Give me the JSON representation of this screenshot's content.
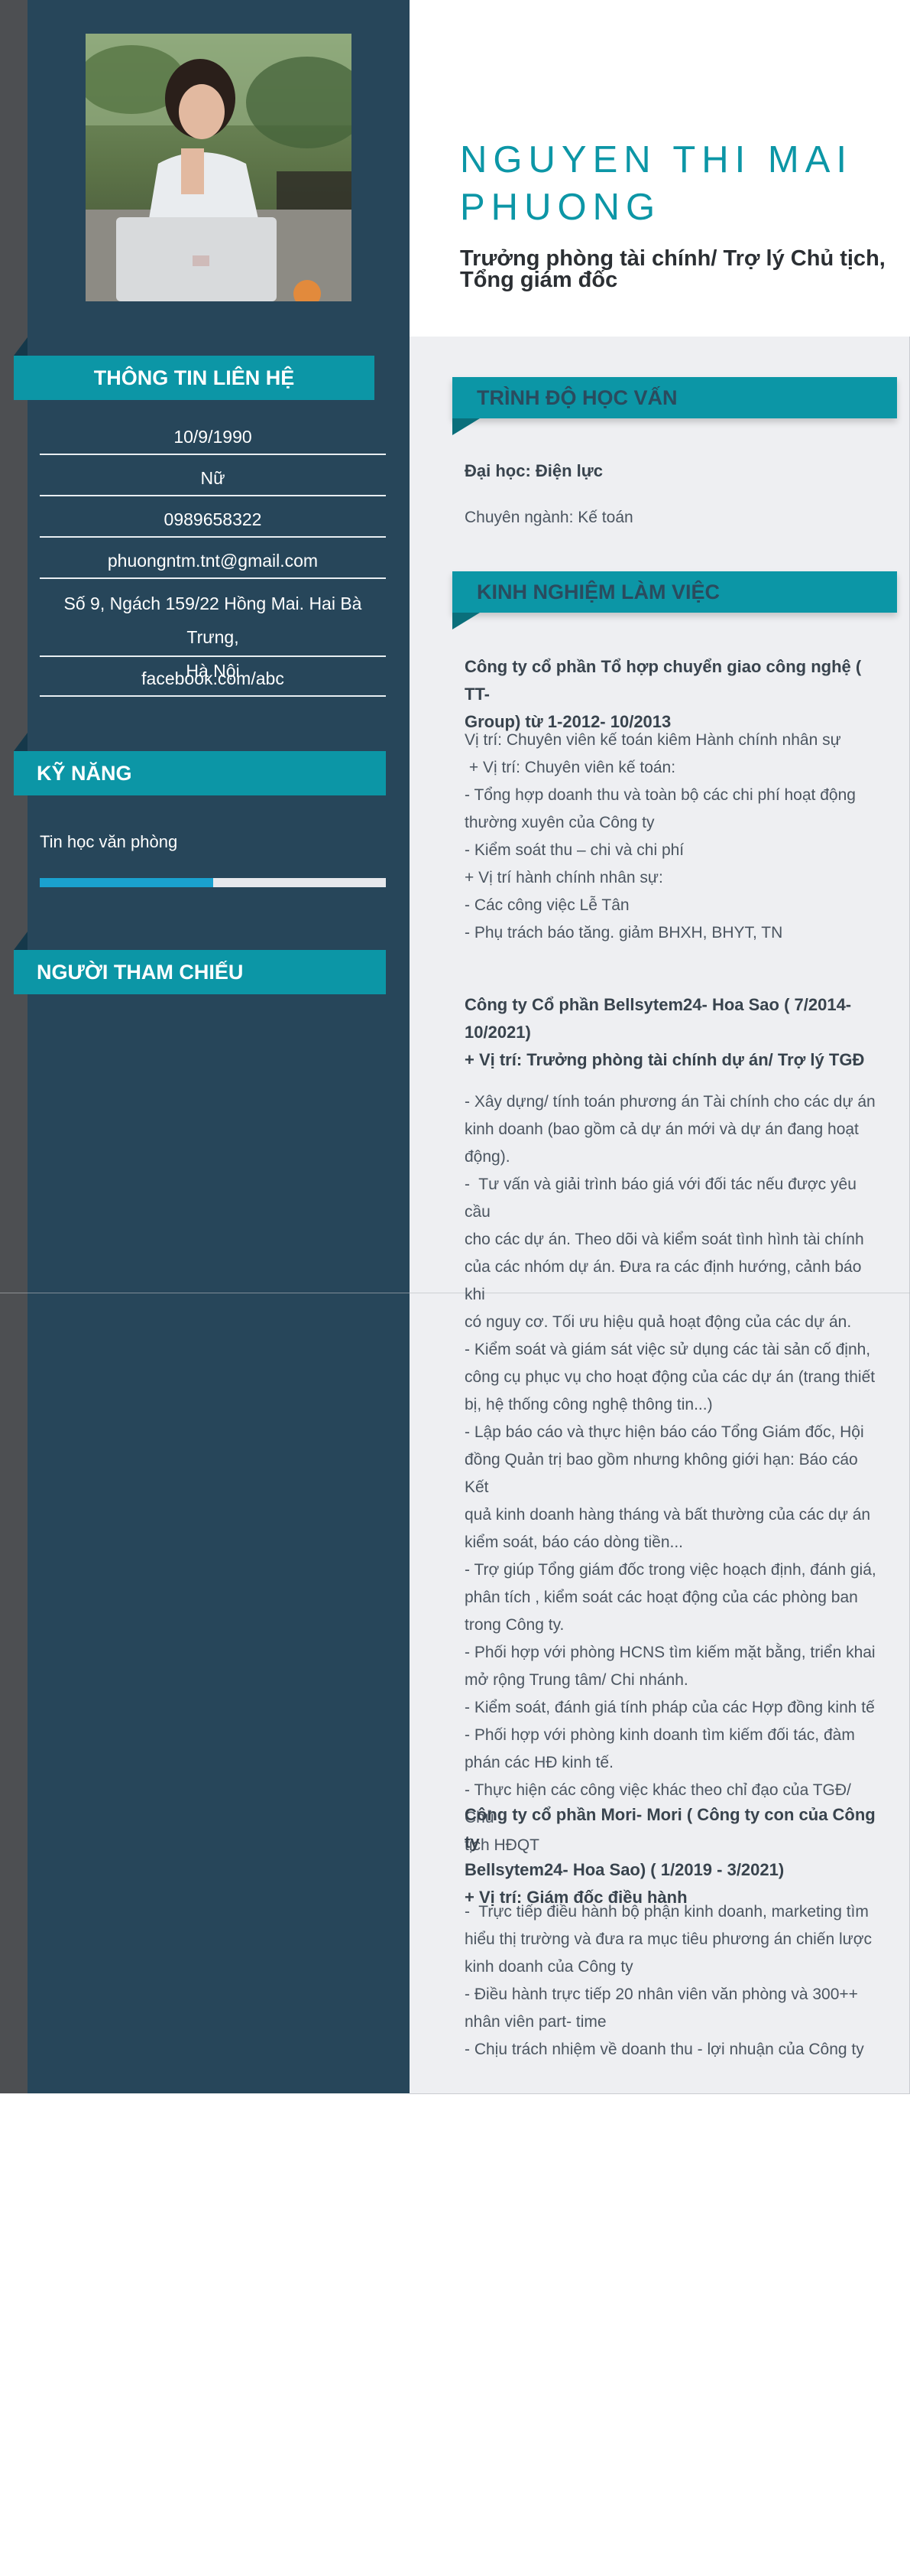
{
  "profile": {
    "name_line1": "NGUYEN THI MAI",
    "name_line2": "PHUONG",
    "title": "Trưởng phòng tài chính/ Trợ lý Chủ tịch, Tổng giám đốc"
  },
  "contact": {
    "heading": "THÔNG TIN LIÊN HỆ",
    "birthday": "10/9/1990",
    "gender": "Nữ",
    "phone": "0989658322",
    "email": "phuongntm.tnt@gmail.com",
    "address_line1": "Số 9, Ngách 159/22 Hồng Mai. Hai Bà Trưng,",
    "address_line2": "Hà Nội",
    "website": "facebook.com/abc"
  },
  "skills": {
    "heading": "KỸ NĂNG",
    "items": [
      {
        "name": "Tin học văn phòng",
        "level": 0.5
      }
    ]
  },
  "references": {
    "heading": "NGƯỜI THAM CHIẾU"
  },
  "education": {
    "heading": "TRÌNH ĐỘ HỌC VẤN",
    "school": "Đại học: Điện lực",
    "major": "Chuyên ngành: Kế toán"
  },
  "experience": {
    "heading": "KINH NGHIỆM LÀM VIỆC",
    "jobs": [
      {
        "company": [
          "Công ty cổ phần Tổ hợp chuyển giao công nghệ ( TT-",
          "Group) từ 1-2012- 10/2013"
        ],
        "details": [
          "Vị trí: Chuyên viên kế toán kiêm Hành chính nhân sự",
          " + Vị trí: Chuyên viên kế toán:",
          "- Tổng hợp doanh thu và toàn bộ các chi phí hoạt động",
          "thường xuyên của Công ty",
          "- Kiểm soát thu – chi và chi phí",
          "+ Vị trí hành chính nhân sự:",
          "- Các công việc Lễ Tân",
          "- Phụ trách báo tăng. giảm BHXH, BHYT, TN"
        ]
      },
      {
        "company": [
          "Công ty Cổ phần Bellsytem24- Hoa Sao ( 7/2014-",
          "10/2021)",
          "+ Vị trí: Trưởng phòng tài chính dự án/ Trợ lý TGĐ"
        ],
        "details": [
          "- Xây dựng/ tính toán phương án Tài chính cho các dự án",
          "kinh doanh (bao gồm cả dự án mới và dự án đang hoạt",
          "động).",
          "-  Tư vấn và giải trình báo giá với đối tác nếu được yêu cầu",
          "cho các dự án. Theo dõi và kiểm soát tình hình tài chính",
          "của các nhóm dự án. Đưa ra các định hướng, cảnh báo khi",
          "có nguy cơ. Tối ưu hiệu quả hoạt động của các dự án.",
          "- Kiểm soát và giám sát việc sử dụng các tài sản cố định,",
          "công cụ phục vụ cho hoạt động của các dự án (trang thiết",
          "bị, hệ thống công nghệ thông tin...)",
          "- Lập báo cáo và thực hiện báo cáo Tổng Giám đốc, Hội",
          "đồng Quản trị bao gồm nhưng không giới hạn: Báo cáo Kết",
          "quả kinh doanh hàng tháng và bất thường của các dự án",
          "kiểm soát, báo cáo dòng tiền...",
          "- Trợ giúp Tổng giám đốc trong việc hoạch định, đánh giá,",
          "phân tích , kiểm soát các hoạt động của các phòng ban",
          "trong Công ty.",
          "- Phối hợp với phòng HCNS tìm kiếm mặt bằng, triển khai",
          "mở rộng Trung tâm/ Chi nhánh.",
          "- Kiểm soát, đánh giá tính pháp của các Hợp đồng kinh tế",
          "- Phối hợp với phòng kinh doanh tìm kiếm đối tác, đàm",
          "phán các HĐ kinh tế.",
          "- Thực hiện các công việc khác theo chỉ đạo của TGĐ/ Chủ",
          "tịch HĐQT"
        ]
      },
      {
        "company": [
          "Công ty cổ phần Mori- Mori ( Công ty con của Công ty",
          "Bellsytem24- Hoa Sao) ( 1/2019 - 3/2021)",
          "+ Vị trí: Giám đốc điều hành"
        ],
        "details": [
          "-  Trực tiếp điều hành bộ phận kinh doanh, marketing tìm",
          "hiểu thị trường và đưa ra mục tiêu phương án chiến lược",
          "kinh doanh của Công ty",
          "- Điều hành trực tiếp 20 nhân viên văn phòng và 300++",
          "nhân viên part- time",
          "- Chịu trách nhiệm về doanh thu - lợi nhuận của Công ty"
        ]
      }
    ]
  }
}
